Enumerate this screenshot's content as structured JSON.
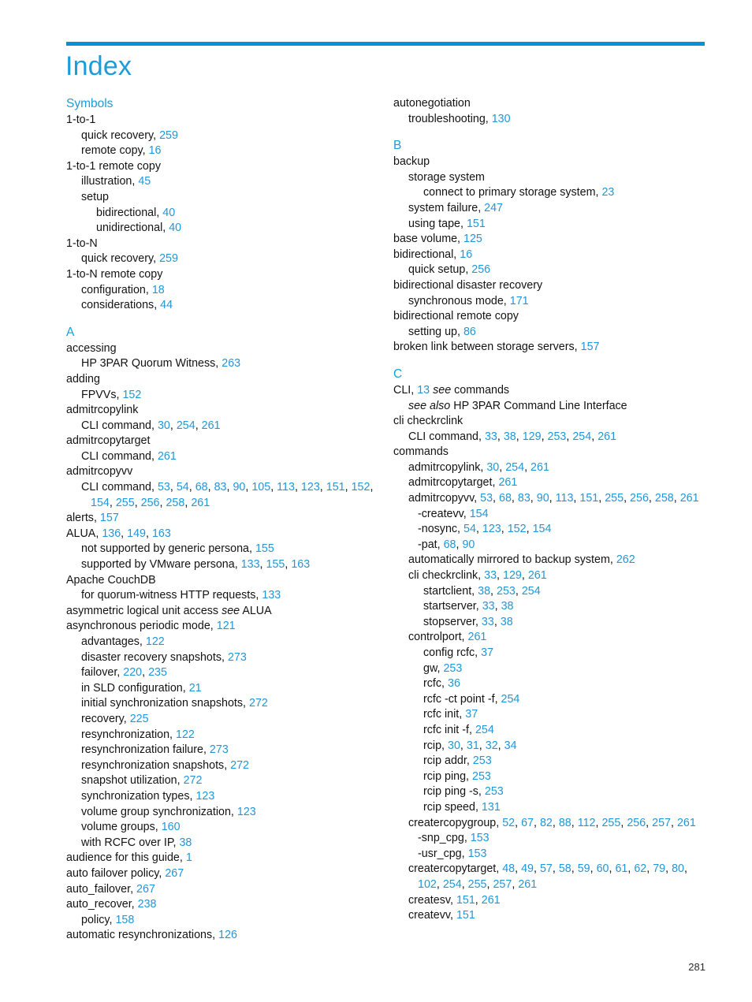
{
  "document": {
    "title": "Index",
    "page_number": "281",
    "accent_color": "#1b9dd9",
    "rule_color": "#0a90d0",
    "reference_color": "#2196d8"
  },
  "columns": [
    {
      "name": "left-column",
      "sections": [
        {
          "heading": "Symbols",
          "entries": [
            {
              "level": 0,
              "text": "1-to-1",
              "refs": []
            },
            {
              "level": 1,
              "text": "quick recovery,",
              "refs": [
                "259"
              ]
            },
            {
              "level": 1,
              "text": "remote copy,",
              "refs": [
                "16"
              ]
            },
            {
              "level": 0,
              "text": "1-to-1  remote copy",
              "refs": []
            },
            {
              "level": 1,
              "text": "illustration,",
              "refs": [
                "45"
              ]
            },
            {
              "level": 1,
              "text": "setup",
              "refs": []
            },
            {
              "level": 2,
              "text": "bidirectional,",
              "refs": [
                "40"
              ]
            },
            {
              "level": 2,
              "text": "unidirectional,",
              "refs": [
                "40"
              ]
            },
            {
              "level": 0,
              "text": "1-to-N",
              "refs": []
            },
            {
              "level": 1,
              "text": "quick recovery,",
              "refs": [
                "259"
              ]
            },
            {
              "level": 0,
              "text": "1-to-N remote copy",
              "refs": []
            },
            {
              "level": 1,
              "text": "configuration,",
              "refs": [
                "18"
              ]
            },
            {
              "level": 1,
              "text": "considerations,",
              "refs": [
                "44"
              ]
            }
          ]
        },
        {
          "heading": "A",
          "entries": [
            {
              "level": 0,
              "text": "accessing",
              "refs": []
            },
            {
              "level": 1,
              "text": "HP 3PAR Quorum Witness,",
              "refs": [
                "263"
              ]
            },
            {
              "level": 0,
              "text": "adding",
              "refs": []
            },
            {
              "level": 1,
              "text": "FPVVs,",
              "refs": [
                "152"
              ]
            },
            {
              "level": 0,
              "text": "admitrcopylink",
              "refs": []
            },
            {
              "level": 1,
              "text": "CLI command,",
              "refs": [
                "30",
                "254",
                "261"
              ]
            },
            {
              "level": 0,
              "text": "admitrcopytarget",
              "refs": []
            },
            {
              "level": 1,
              "text": "CLI command,",
              "refs": [
                "261"
              ]
            },
            {
              "level": 0,
              "text": "admitrcopyvv",
              "refs": []
            },
            {
              "level": 1,
              "text": "CLI command,",
              "refs": [
                "53",
                "54",
                "68",
                "83",
                "90",
                "105",
                "113",
                "123",
                "151",
                "152",
                "154",
                "255",
                "256",
                "258",
                "261"
              ]
            },
            {
              "level": 0,
              "text": "alerts,",
              "refs": [
                "157"
              ]
            },
            {
              "level": 0,
              "text": "ALUA,",
              "refs": [
                "136",
                "149",
                "163"
              ]
            },
            {
              "level": 1,
              "text": "not supported by generic persona,",
              "refs": [
                "155"
              ]
            },
            {
              "level": 1,
              "text": "supported by VMware persona,",
              "refs": [
                "133",
                "155",
                "163"
              ]
            },
            {
              "level": 0,
              "text": "Apache CouchDB",
              "refs": []
            },
            {
              "level": 1,
              "text": "for quorum-witness HTTP requests,",
              "refs": [
                "133"
              ]
            },
            {
              "level": 0,
              "text": "asymmetric logical unit access",
              "italic": "see",
              "after_italic": "ALUA",
              "refs": []
            },
            {
              "level": 0,
              "text": "asynchronous periodic mode,",
              "refs": [
                "121"
              ]
            },
            {
              "level": 1,
              "text": "advantages,",
              "refs": [
                "122"
              ]
            },
            {
              "level": 1,
              "text": "disaster recovery snapshots,",
              "refs": [
                "273"
              ]
            },
            {
              "level": 1,
              "text": "failover,",
              "refs": [
                "220",
                "235"
              ]
            },
            {
              "level": 1,
              "text": "in SLD configuration,",
              "refs": [
                "21"
              ]
            },
            {
              "level": 1,
              "text": "initial synchronization snapshots,",
              "refs": [
                "272"
              ]
            },
            {
              "level": 1,
              "text": "recovery,",
              "refs": [
                "225"
              ]
            },
            {
              "level": 1,
              "text": "resynchronization,",
              "refs": [
                "122"
              ]
            },
            {
              "level": 1,
              "text": "resynchronization failure,",
              "refs": [
                "273"
              ]
            },
            {
              "level": 1,
              "text": "resynchronization snapshots,",
              "refs": [
                "272"
              ]
            },
            {
              "level": 1,
              "text": "snapshot utilization,",
              "refs": [
                "272"
              ]
            },
            {
              "level": 1,
              "text": "synchronization types,",
              "refs": [
                "123"
              ]
            },
            {
              "level": 1,
              "text": "volume group synchronization,",
              "refs": [
                "123"
              ]
            },
            {
              "level": 1,
              "text": "volume groups,",
              "refs": [
                "160"
              ]
            },
            {
              "level": 1,
              "text": "with RCFC over IP,",
              "refs": [
                "38"
              ]
            },
            {
              "level": 0,
              "text": "audience for this guide,",
              "refs": [
                "1"
              ]
            },
            {
              "level": 0,
              "text": "auto failover policy,",
              "refs": [
                "267"
              ]
            },
            {
              "level": 0,
              "text": "auto_failover,",
              "refs": [
                "267"
              ]
            },
            {
              "level": 0,
              "text": "auto_recover,",
              "refs": [
                "238"
              ]
            },
            {
              "level": 1,
              "text": "policy,",
              "refs": [
                "158"
              ]
            },
            {
              "level": 0,
              "text": "automatic resynchronizations,",
              "refs": [
                "126"
              ]
            }
          ]
        }
      ]
    },
    {
      "name": "right-column",
      "sections": [
        {
          "heading": "",
          "entries": [
            {
              "level": 0,
              "text": "autonegotiation",
              "refs": []
            },
            {
              "level": 1,
              "text": "troubleshooting,",
              "refs": [
                "130"
              ]
            }
          ]
        },
        {
          "heading": "B",
          "entries": [
            {
              "level": 0,
              "text": "backup",
              "refs": []
            },
            {
              "level": 1,
              "text": "storage system",
              "refs": []
            },
            {
              "level": 2,
              "text": "connect to primary storage system,",
              "refs": [
                "23"
              ]
            },
            {
              "level": 1,
              "text": "system failure,",
              "refs": [
                "247"
              ]
            },
            {
              "level": 1,
              "text": "using tape,",
              "refs": [
                "151"
              ]
            },
            {
              "level": 0,
              "text": "base volume,",
              "refs": [
                "125"
              ]
            },
            {
              "level": 0,
              "text": "bidirectional,",
              "refs": [
                "16"
              ]
            },
            {
              "level": 1,
              "text": "quick setup,",
              "refs": [
                "256"
              ]
            },
            {
              "level": 0,
              "text": "bidirectional disaster recovery",
              "refs": []
            },
            {
              "level": 1,
              "text": "synchronous mode,",
              "refs": [
                "171"
              ]
            },
            {
              "level": 0,
              "text": "bidirectional remote copy",
              "refs": []
            },
            {
              "level": 1,
              "text": "setting up,",
              "refs": [
                "86"
              ]
            },
            {
              "level": 0,
              "text": "broken link between storage servers,",
              "refs": [
                "157"
              ]
            }
          ]
        },
        {
          "heading": "C",
          "entries": [
            {
              "level": 0,
              "text": "CLI,",
              "refs": [
                "13"
              ],
              "italic": "see",
              "after_italic": "commands"
            },
            {
              "level": 1,
              "text": "",
              "italic": "see also",
              "after_italic": "HP 3PAR Command Line Interface",
              "refs": []
            },
            {
              "level": 0,
              "text": "cli checkrclink",
              "refs": []
            },
            {
              "level": 1,
              "text": "CLI command,",
              "refs": [
                "33",
                "38",
                "129",
                "253",
                "254",
                "261"
              ]
            },
            {
              "level": 0,
              "text": "commands",
              "refs": []
            },
            {
              "level": 1,
              "text": "admitrcopylink,",
              "refs": [
                "30",
                "254",
                "261"
              ]
            },
            {
              "level": 1,
              "text": "admitrcopytarget,",
              "refs": [
                "261"
              ]
            },
            {
              "level": 1,
              "text": "admitrcopyvv,",
              "refs": [
                "53",
                "68",
                "83",
                "90",
                "113",
                "151",
                "255",
                "256",
                "258",
                "261"
              ]
            },
            {
              "level": "2f",
              "text": "-createvv,",
              "refs": [
                "154"
              ]
            },
            {
              "level": "2f",
              "text": "-nosync,",
              "refs": [
                "54",
                "123",
                "152",
                "154"
              ]
            },
            {
              "level": "2f",
              "text": "-pat,",
              "refs": [
                "68",
                "90"
              ]
            },
            {
              "level": 1,
              "text": "automatically mirrored to backup system,",
              "refs": [
                "262"
              ]
            },
            {
              "level": 1,
              "text": "cli checkrclink,",
              "refs": [
                "33",
                "129",
                "261"
              ]
            },
            {
              "level": 2,
              "text": "startclient,",
              "refs": [
                "38",
                "253",
                "254"
              ]
            },
            {
              "level": 2,
              "text": "startserver,",
              "refs": [
                "33",
                "38"
              ]
            },
            {
              "level": 2,
              "text": "stopserver,",
              "refs": [
                "33",
                "38"
              ]
            },
            {
              "level": 1,
              "text": "controlport,",
              "refs": [
                "261"
              ]
            },
            {
              "level": 2,
              "text": "config rcfc,",
              "refs": [
                "37"
              ]
            },
            {
              "level": 2,
              "text": "gw,",
              "refs": [
                "253"
              ]
            },
            {
              "level": 2,
              "text": "rcfc,",
              "refs": [
                "36"
              ]
            },
            {
              "level": 2,
              "text": "rcfc -ct point -f,",
              "refs": [
                "254"
              ]
            },
            {
              "level": 2,
              "text": "rcfc init,",
              "refs": [
                "37"
              ]
            },
            {
              "level": 2,
              "text": "rcfc init -f,",
              "refs": [
                "254"
              ]
            },
            {
              "level": 2,
              "text": "rcip,",
              "refs": [
                "30",
                "31",
                "32",
                "34"
              ]
            },
            {
              "level": 2,
              "text": "rcip addr,",
              "refs": [
                "253"
              ]
            },
            {
              "level": 2,
              "text": "rcip ping,",
              "refs": [
                "253"
              ]
            },
            {
              "level": 2,
              "text": "rcip ping -s,",
              "refs": [
                "253"
              ]
            },
            {
              "level": 2,
              "text": "rcip speed,",
              "refs": [
                "131"
              ]
            },
            {
              "level": 1,
              "text": "creatercopygroup,",
              "refs": [
                "52",
                "67",
                "82",
                "88",
                "112",
                "255",
                "256",
                "257",
                "261"
              ]
            },
            {
              "level": "2f",
              "text": "-snp_cpg,",
              "refs": [
                "153"
              ]
            },
            {
              "level": "2f",
              "text": "-usr_cpg,",
              "refs": [
                "153"
              ]
            },
            {
              "level": 1,
              "text": "creatercopytarget,",
              "refs": [
                "48",
                "49",
                "57",
                "58",
                "59",
                "60",
                "61",
                "62",
                "79",
                "80",
                "102",
                "254",
                "255",
                "257",
                "261"
              ]
            },
            {
              "level": 1,
              "text": "createsv,",
              "refs": [
                "151",
                "261"
              ]
            },
            {
              "level": 1,
              "text": "createvv,",
              "refs": [
                "151"
              ]
            }
          ]
        }
      ]
    }
  ]
}
